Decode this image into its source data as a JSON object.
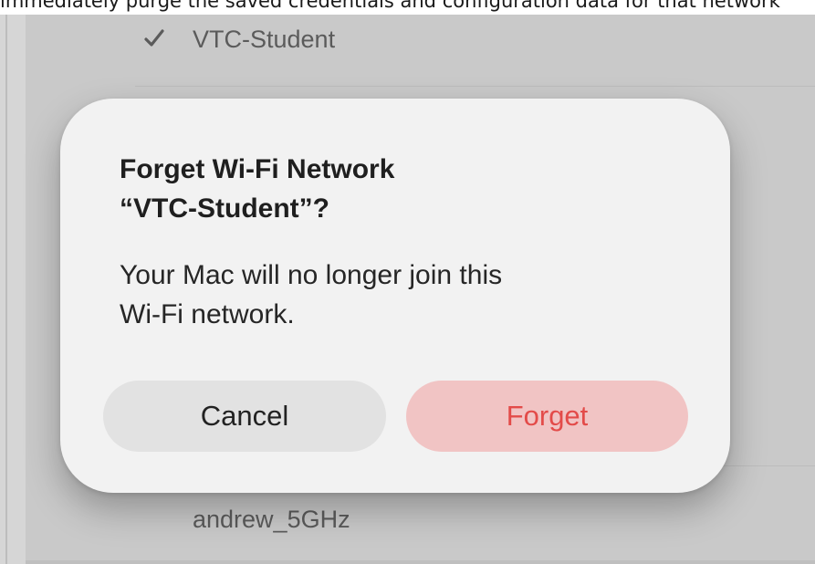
{
  "caption": {
    "text": "immediately purge the saved credentials and configuration data for that network"
  },
  "background": {
    "networks": [
      {
        "name": "VTC-Student",
        "connected": true
      },
      {
        "name": "andrew_5GHz",
        "connected": false
      }
    ]
  },
  "dialog": {
    "title_line1": "Forget Wi-Fi Network",
    "title_line2": "“VTC-Student”?",
    "message_line1": "Your Mac will no longer join this",
    "message_line2": "Wi-Fi network.",
    "cancel_label": "Cancel",
    "forget_label": "Forget"
  },
  "colors": {
    "destructive_text": "#e34b49",
    "destructive_fill": "#f1c4c4",
    "dialog_bg": "#f2f2f2"
  },
  "icons": {
    "connected": "checkmark-icon"
  }
}
